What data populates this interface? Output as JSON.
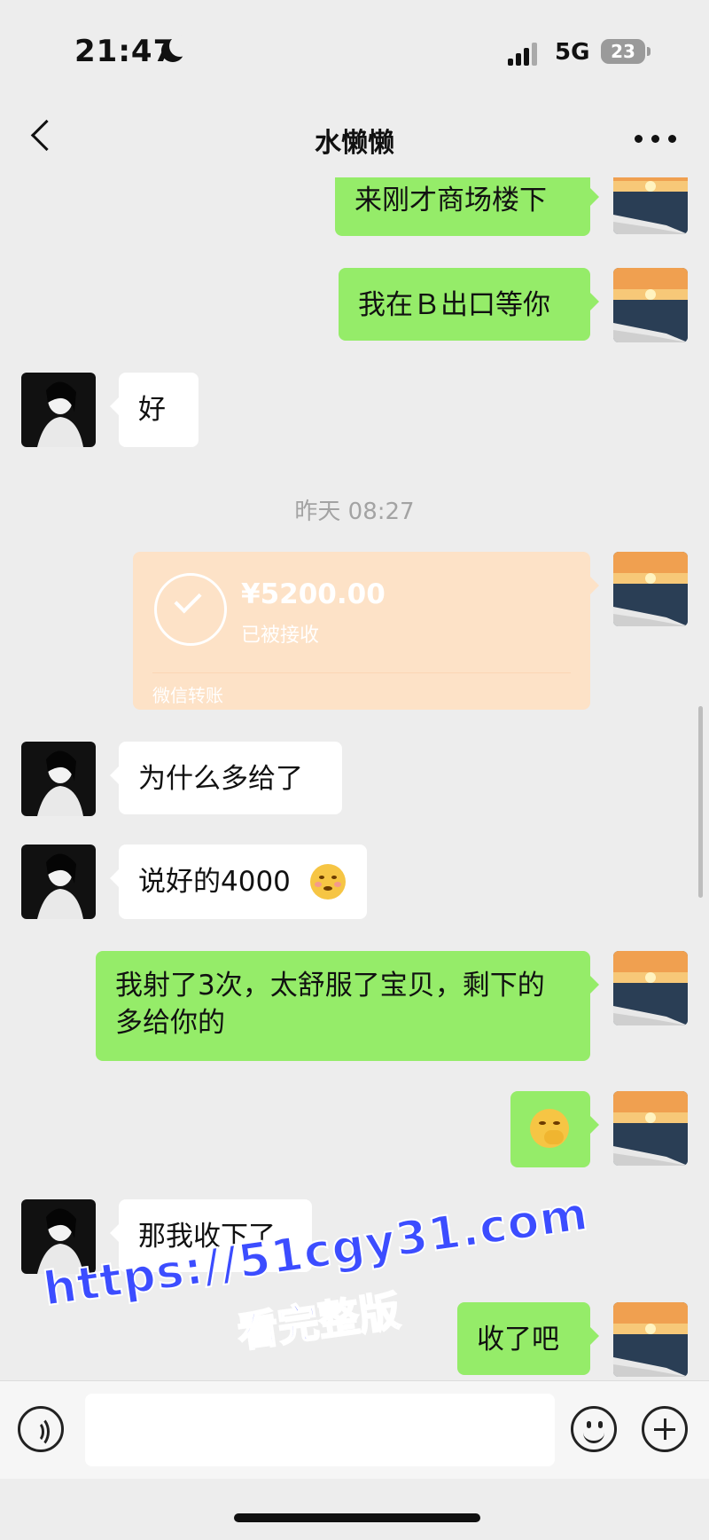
{
  "status_bar": {
    "time": "21:47",
    "network": "5G",
    "battery": "23"
  },
  "nav": {
    "title": "水懒懒"
  },
  "messages": {
    "m1": "来刚才商场楼下",
    "m2": "我在Ｂ出口等你",
    "m3": "好",
    "time_sep": "昨天 08:27",
    "transfer": {
      "amount": "¥5200.00",
      "status": "已被接收",
      "brand": "微信转账"
    },
    "m4": "为什么多给了",
    "m5": "说好的4000",
    "m6": "我射了3次，太舒服了宝贝，剩下的多给你的",
    "m8": "那我收下了",
    "m9": "收了吧"
  },
  "input_bar": {
    "placeholder": ""
  },
  "watermark": {
    "line1": "https://51cgy31.com",
    "line2": "看完整版"
  },
  "icons": [
    "back-icon",
    "more-icon",
    "avatar-contact",
    "avatar-self",
    "check-icon",
    "voice-icon",
    "emoji-icon",
    "plus-icon",
    "blushing-emoji",
    "shy-emoji",
    "moon-icon",
    "signal-icon"
  ],
  "colors": {
    "background": "#ededed",
    "sent_bubble": "#95ec69",
    "received_bubble": "#ffffff",
    "transfer_card": "#fde2c7",
    "watermark": "#3c4dff"
  }
}
